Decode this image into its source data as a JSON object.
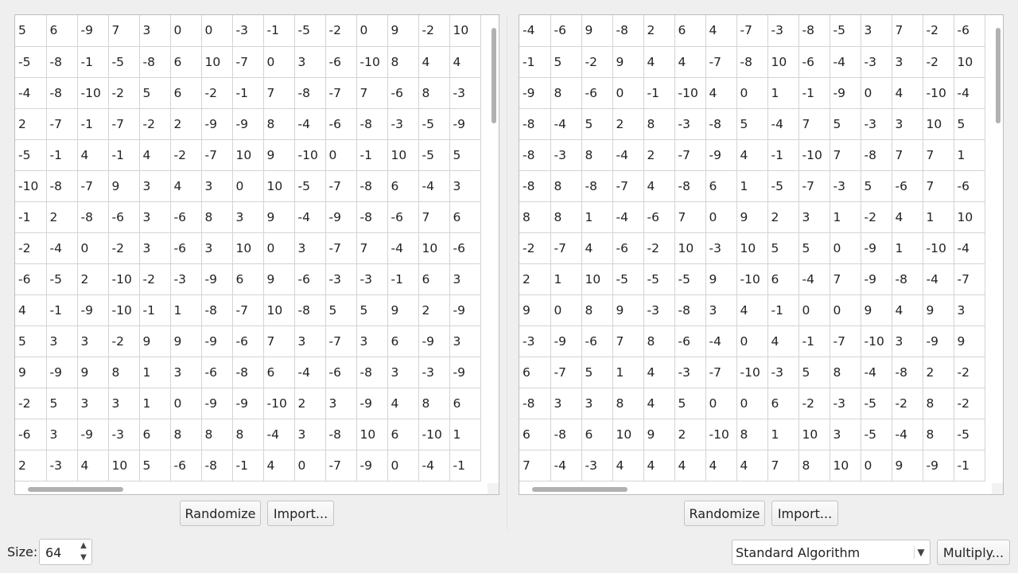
{
  "left_matrix": {
    "rows": [
      [
        "5",
        "6",
        "-9",
        "7",
        "3",
        "0",
        "0",
        "-3",
        "-1",
        "-5",
        "-2",
        "0",
        "9",
        "-2",
        "10"
      ],
      [
        "-5",
        "-8",
        "-1",
        "-5",
        "-8",
        "6",
        "10",
        "-7",
        "0",
        "3",
        "-6",
        "-10",
        "8",
        "4",
        "4"
      ],
      [
        "-4",
        "-8",
        "-10",
        "-2",
        "5",
        "6",
        "-2",
        "-1",
        "7",
        "-8",
        "-7",
        "7",
        "-6",
        "8",
        "-3"
      ],
      [
        "2",
        "-7",
        "-1",
        "-7",
        "-2",
        "2",
        "-9",
        "-9",
        "8",
        "-4",
        "-6",
        "-8",
        "-3",
        "-5",
        "-9"
      ],
      [
        "-5",
        "-1",
        "4",
        "-1",
        "4",
        "-2",
        "-7",
        "10",
        "9",
        "-10",
        "0",
        "-1",
        "10",
        "-5",
        "5"
      ],
      [
        "-10",
        "-8",
        "-7",
        "9",
        "3",
        "4",
        "3",
        "0",
        "10",
        "-5",
        "-7",
        "-8",
        "6",
        "-4",
        "3"
      ],
      [
        "-1",
        "2",
        "-8",
        "-6",
        "3",
        "-6",
        "8",
        "3",
        "9",
        "-4",
        "-9",
        "-8",
        "-6",
        "7",
        "6"
      ],
      [
        "-2",
        "-4",
        "0",
        "-2",
        "3",
        "-6",
        "3",
        "10",
        "0",
        "3",
        "-7",
        "7",
        "-4",
        "10",
        "-6"
      ],
      [
        "-6",
        "-5",
        "2",
        "-10",
        "-2",
        "-3",
        "-9",
        "6",
        "9",
        "-6",
        "-3",
        "-3",
        "-1",
        "6",
        "3"
      ],
      [
        "4",
        "-1",
        "-9",
        "-10",
        "-1",
        "1",
        "-8",
        "-7",
        "10",
        "-8",
        "5",
        "5",
        "9",
        "2",
        "-9"
      ],
      [
        "5",
        "3",
        "3",
        "-2",
        "9",
        "9",
        "-9",
        "-6",
        "7",
        "3",
        "-7",
        "3",
        "6",
        "-9",
        "3"
      ],
      [
        "9",
        "-9",
        "9",
        "8",
        "1",
        "3",
        "-6",
        "-8",
        "6",
        "-4",
        "-6",
        "-8",
        "3",
        "-3",
        "-9"
      ],
      [
        "-2",
        "5",
        "3",
        "3",
        "1",
        "0",
        "-9",
        "-9",
        "-10",
        "2",
        "3",
        "-9",
        "4",
        "8",
        "6"
      ],
      [
        "-6",
        "3",
        "-9",
        "-3",
        "6",
        "8",
        "8",
        "8",
        "-4",
        "3",
        "-8",
        "10",
        "6",
        "-10",
        "1"
      ],
      [
        "2",
        "-3",
        "4",
        "10",
        "5",
        "-6",
        "-8",
        "-1",
        "4",
        "0",
        "-7",
        "-9",
        "0",
        "-4",
        "-1"
      ]
    ],
    "randomize_label": "Randomize",
    "import_label": "Import..."
  },
  "right_matrix": {
    "rows": [
      [
        "-4",
        "-6",
        "9",
        "-8",
        "2",
        "6",
        "4",
        "-7",
        "-3",
        "-8",
        "-5",
        "3",
        "7",
        "-2",
        "-6"
      ],
      [
        "-1",
        "5",
        "-2",
        "9",
        "4",
        "4",
        "-7",
        "-8",
        "10",
        "-6",
        "-4",
        "-3",
        "3",
        "-2",
        "10"
      ],
      [
        "-9",
        "8",
        "-6",
        "0",
        "-1",
        "-10",
        "4",
        "0",
        "1",
        "-1",
        "-9",
        "0",
        "4",
        "-10",
        "-4"
      ],
      [
        "-8",
        "-4",
        "5",
        "2",
        "8",
        "-3",
        "-8",
        "5",
        "-4",
        "7",
        "5",
        "-3",
        "3",
        "10",
        "5"
      ],
      [
        "-8",
        "-3",
        "8",
        "-4",
        "2",
        "-7",
        "-9",
        "4",
        "-1",
        "-10",
        "7",
        "-8",
        "7",
        "7",
        "1"
      ],
      [
        "-8",
        "8",
        "-8",
        "-7",
        "4",
        "-8",
        "6",
        "1",
        "-5",
        "-7",
        "-3",
        "5",
        "-6",
        "7",
        "-6"
      ],
      [
        "8",
        "8",
        "1",
        "-4",
        "-6",
        "7",
        "0",
        "9",
        "2",
        "3",
        "1",
        "-2",
        "4",
        "1",
        "10"
      ],
      [
        "-2",
        "-7",
        "4",
        "-6",
        "-2",
        "10",
        "-3",
        "10",
        "5",
        "5",
        "0",
        "-9",
        "1",
        "-10",
        "-4"
      ],
      [
        "2",
        "1",
        "10",
        "-5",
        "-5",
        "-5",
        "9",
        "-10",
        "6",
        "-4",
        "7",
        "-9",
        "-8",
        "-4",
        "-7"
      ],
      [
        "9",
        "0",
        "8",
        "9",
        "-3",
        "-8",
        "3",
        "4",
        "-1",
        "0",
        "0",
        "9",
        "4",
        "9",
        "3"
      ],
      [
        "-3",
        "-9",
        "-6",
        "7",
        "8",
        "-6",
        "-4",
        "0",
        "4",
        "-1",
        "-7",
        "-10",
        "3",
        "-9",
        "9"
      ],
      [
        "6",
        "-7",
        "5",
        "1",
        "4",
        "-3",
        "-7",
        "-10",
        "-3",
        "5",
        "8",
        "-4",
        "-8",
        "2",
        "-2"
      ],
      [
        "-8",
        "3",
        "3",
        "8",
        "4",
        "5",
        "0",
        "0",
        "6",
        "-2",
        "-3",
        "-5",
        "-2",
        "8",
        "-2"
      ],
      [
        "6",
        "-8",
        "6",
        "10",
        "9",
        "2",
        "-10",
        "8",
        "1",
        "10",
        "3",
        "-5",
        "-4",
        "8",
        "-5"
      ],
      [
        "7",
        "-4",
        "-3",
        "4",
        "4",
        "4",
        "4",
        "4",
        "7",
        "8",
        "10",
        "0",
        "9",
        "-9",
        "-1"
      ]
    ],
    "randomize_label": "Randomize",
    "import_label": "Import..."
  },
  "footer": {
    "size_label": "Size:",
    "size_value": "64",
    "algorithm_selected": "Standard Algorithm",
    "multiply_label": "Multiply..."
  }
}
